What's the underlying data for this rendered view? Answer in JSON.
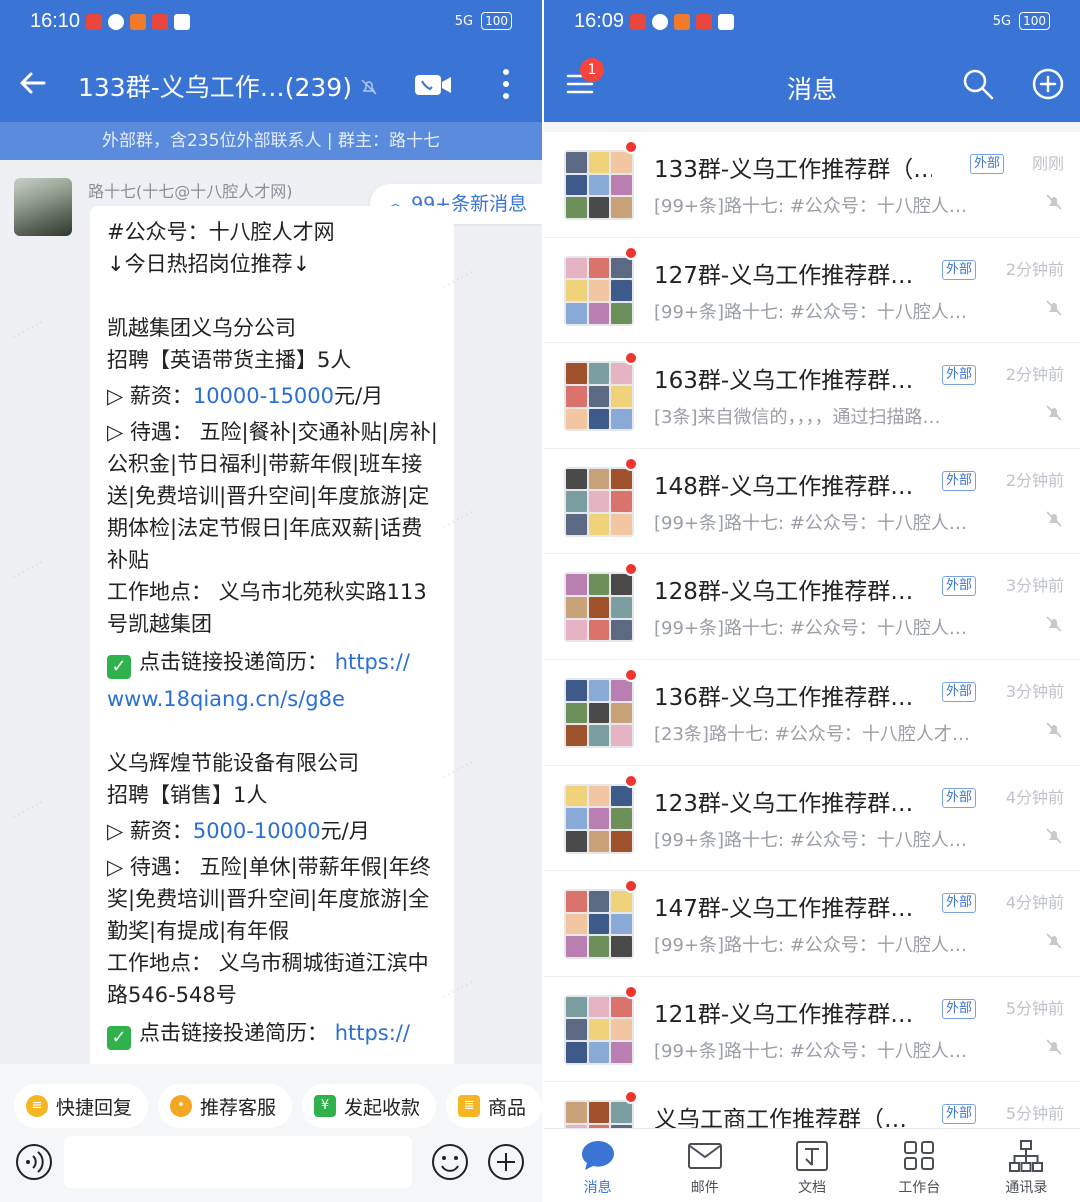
{
  "left": {
    "status": {
      "time": "16:10",
      "battery": "100",
      "signal": "5G"
    },
    "title": "133群-义乌工作…(239)",
    "banner": "外部群，含235位外部联系人 | 群主：路十七",
    "sender": "路十七(十七@十八腔人才网)",
    "new_messages": "99+条新消息",
    "message": {
      "l1": "#公众号：十八腔人才网",
      "l2": "↓今日热招岗位推荐↓",
      "job1_company": "凯越集团义乌分公司",
      "job1_title": "招聘【英语带货主播】5人",
      "job1_salary_label": "▷ 薪资：",
      "job1_salary_value": "10000-15000",
      "job1_salary_unit": "元/月",
      "job1_benefits": "▷ 待遇： 五险|餐补|交通补贴|房补|公积金|节日福利|带薪年假|班车接送|免费培训|晋升空间|年度旅游|定期体检|法定节假日|年底双薪|话费补贴",
      "job1_location": "工作地点： 义乌市北苑秋实路113号凯越集团",
      "apply_label": "点击链接投递简历：",
      "apply_link_a": "https://",
      "apply_link_b": "www.18qiang.cn/s/g8e",
      "job2_company": "义乌辉煌节能设备有限公司",
      "job2_title": "招聘【销售】1人",
      "job2_salary_label": "▷ 薪资：",
      "job2_salary_value": "5000-10000",
      "job2_salary_unit": "元/月",
      "job2_benefits": "▷ 待遇： 五险|单休|带薪年假|年终奖|免费培训|晋升空间|年度旅游|全勤奖|有提成|有年假",
      "job2_location": "工作地点： 义乌市稠城街道江滨中路546-548号",
      "apply2_label": "点击链接投递简历：",
      "apply2_link": "https://"
    },
    "quick": [
      "快捷回复",
      "推荐客服",
      "发起收款",
      "商品"
    ]
  },
  "right": {
    "status": {
      "time": "16:09",
      "battery": "100",
      "signal": "5G"
    },
    "title": "消息",
    "menu_badge": "1",
    "ext_tag": "外部",
    "conversations": [
      {
        "name": "133群-义乌工作推荐群（…",
        "time": "刚刚",
        "preview": "[99+条]路十七: #公众号：十八腔人…"
      },
      {
        "name": "127群-义乌工作推荐群…",
        "time": "2分钟前",
        "preview": "[99+条]路十七: #公众号：十八腔人…"
      },
      {
        "name": "163群-义乌工作推荐群…",
        "time": "2分钟前",
        "preview": "[3条]来自微信的，，，，通过扫描路…"
      },
      {
        "name": "148群-义乌工作推荐群…",
        "time": "2分钟前",
        "preview": "[99+条]路十七: #公众号：十八腔人…"
      },
      {
        "name": "128群-义乌工作推荐群…",
        "time": "3分钟前",
        "preview": "[99+条]路十七: #公众号：十八腔人…"
      },
      {
        "name": "136群-义乌工作推荐群…",
        "time": "3分钟前",
        "preview": "[23条]路十七: #公众号：十八腔人才…"
      },
      {
        "name": "123群-义乌工作推荐群…",
        "time": "4分钟前",
        "preview": "[99+条]路十七: #公众号：十八腔人…"
      },
      {
        "name": "147群-义乌工作推荐群…",
        "time": "4分钟前",
        "preview": "[99+条]路十七: #公众号：十八腔人…"
      },
      {
        "name": "121群-义乌工作推荐群…",
        "time": "5分钟前",
        "preview": "[99+条]路十七: #公众号：十八腔人…"
      },
      {
        "name": "义乌工商工作推荐群（…",
        "time": "5分钟前",
        "preview": ""
      }
    ],
    "tabs": [
      "消息",
      "邮件",
      "文档",
      "工作台",
      "通讯录"
    ]
  },
  "colors": {
    "header": "#3a74d4",
    "link": "#2a6fd6",
    "badge": "#f2352c"
  }
}
